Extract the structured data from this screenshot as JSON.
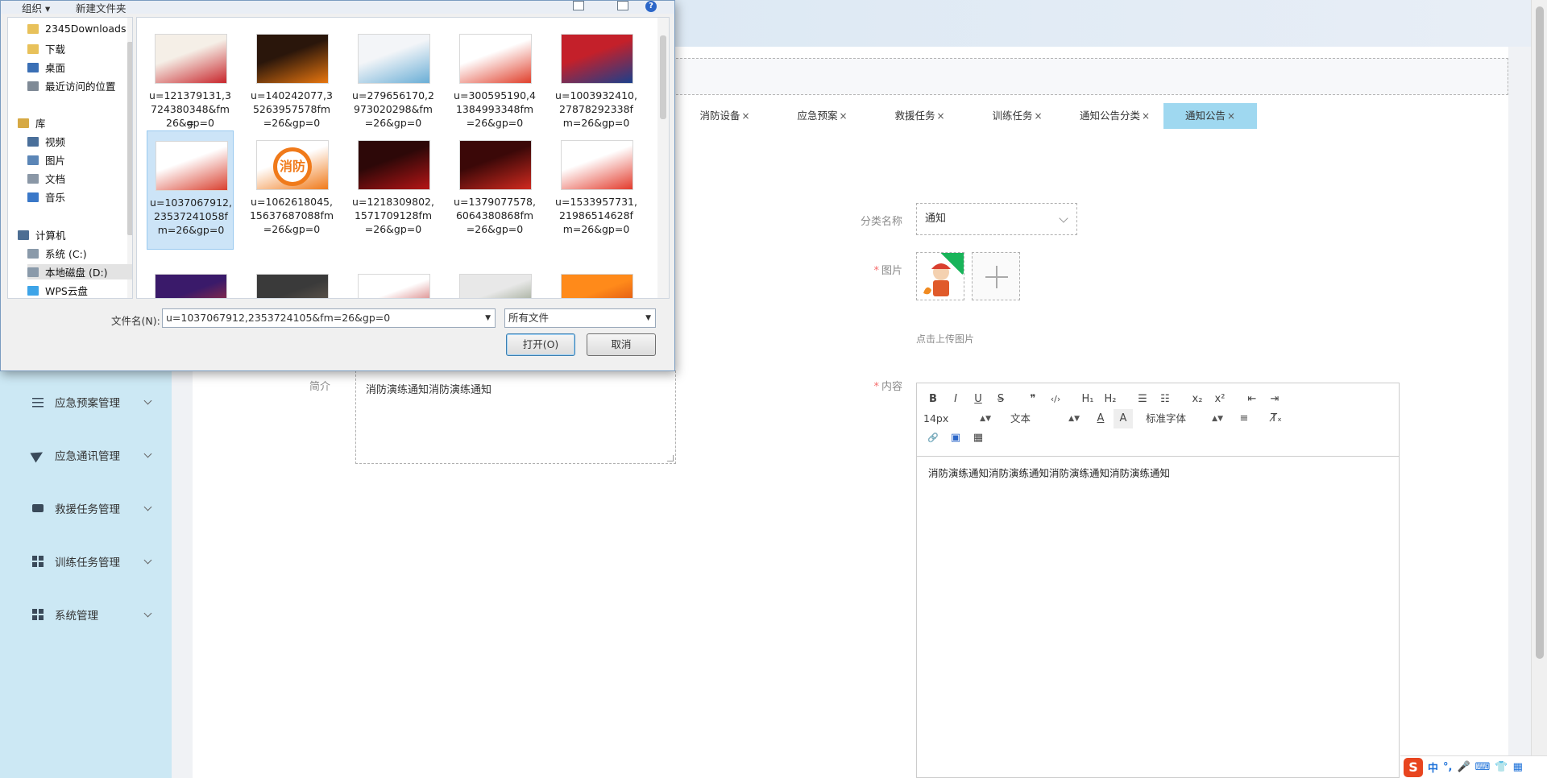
{
  "app": {
    "tabs": [
      {
        "label": "消防设备",
        "close": "×"
      },
      {
        "label": "应急预案",
        "close": "×"
      },
      {
        "label": "救援任务",
        "close": "×"
      },
      {
        "label": "训练任务",
        "close": "×"
      },
      {
        "label": "通知公告分类",
        "close": "×"
      },
      {
        "label": "通知公告",
        "close": "×"
      }
    ],
    "sidebar": {
      "items": [
        {
          "label": "应急预案管理",
          "icon": "sliders-icon"
        },
        {
          "label": "应急通讯管理",
          "icon": "paper-plane-icon"
        },
        {
          "label": "救援任务管理",
          "icon": "truck-icon"
        },
        {
          "label": "训练任务管理",
          "icon": "grid-icon"
        },
        {
          "label": "系统管理",
          "icon": "grid-icon"
        }
      ]
    },
    "form": {
      "category_label": "分类名称",
      "category_value": "通知",
      "image_label": "图片",
      "upload_hint": "点击上传图片",
      "intro_label": "简介",
      "intro_value": "消防演练通知消防演练通知",
      "content_label": "内容",
      "required_mark": "*",
      "content_value": "消防演练通知消防演练通知消防演练通知消防演练通知"
    },
    "editor": {
      "font_size": "14px",
      "block_format": "文本",
      "font_family": "标准字体",
      "bold": "B",
      "italic": "I",
      "underline": "U",
      "strike": "S",
      "quote": "❞",
      "code": "‹/›",
      "h1": "H₁",
      "h2": "H₂",
      "ordered_list": "☰",
      "bullet_list": "☷",
      "subscript": "x₂",
      "superscript": "x²",
      "outdent": "⇤",
      "indent": "⇥",
      "font_color": "A",
      "bg_color": "A",
      "align": "≡",
      "clear": "T̸ₓ",
      "link": "🔗",
      "image": "▣",
      "video": "▦",
      "select_arrow": "▲▼"
    },
    "ime": {
      "logo": "S",
      "lang": "中",
      "punct": "°,",
      "mic": "🎤",
      "kbd": "⌨",
      "skin": "👕",
      "menu": "▦"
    }
  },
  "dialog": {
    "toolbar": {
      "organize": "组织 ▾",
      "new_folder": "新建文件夹",
      "help": "?"
    },
    "nav": [
      {
        "label": "2345Downloads",
        "icon": "folder-icon",
        "color": "#e8c15a"
      },
      {
        "label": "下载",
        "icon": "download-folder-icon",
        "color": "#e8c15a"
      },
      {
        "label": "桌面",
        "icon": "desktop-icon",
        "color": "#3a6fb5"
      },
      {
        "label": "最近访问的位置",
        "icon": "recent-places-icon",
        "color": "#7f8a96"
      },
      {
        "label": "库",
        "icon": "library-icon",
        "color": "#d6a944"
      },
      {
        "label": "视频",
        "icon": "video-icon",
        "color": "#4a6f9a"
      },
      {
        "label": "图片",
        "icon": "pictures-icon",
        "color": "#5b86b7"
      },
      {
        "label": "文档",
        "icon": "documents-icon",
        "color": "#8a97a6"
      },
      {
        "label": "音乐",
        "icon": "music-icon",
        "color": "#3a78c8"
      },
      {
        "label": "计算机",
        "icon": "computer-icon",
        "color": "#4d6e93"
      },
      {
        "label": "系统 (C:)",
        "icon": "drive-c-icon",
        "color": "#8a9aaa"
      },
      {
        "label": "本地磁盘 (D:)",
        "icon": "drive-d-icon",
        "color": "#8a9aaa"
      },
      {
        "label": "WPS云盘",
        "icon": "cloud-icon",
        "color": "#3da4e8"
      }
    ],
    "files": [
      {
        "name": "u=121379131,3724380348&fm=26&gp=0",
        "lines": [
          "u=121379131,3",
          "724380348&fm=",
          "26&gp=0"
        ],
        "colors": [
          "#f5efe7",
          "#c8262c"
        ]
      },
      {
        "name": "u=140242077,35263957578fm=26&gp=0",
        "lines": [
          "u=140242077,3",
          "5263957578fm",
          "=26&gp=0"
        ],
        "colors": [
          "#2a160b",
          "#e8760f"
        ]
      },
      {
        "name": "u=279656170,2973020298&fm=26&gp=0",
        "lines": [
          "u=279656170,2",
          "973020298&fm",
          "=26&gp=0"
        ],
        "colors": [
          "#f3f5f8",
          "#6aaed6"
        ]
      },
      {
        "name": "u=300595190,41384993348fm=26&gp=0",
        "lines": [
          "u=300595190,4",
          "1384993348fm",
          "=26&gp=0"
        ],
        "colors": [
          "#ffffff",
          "#e0402c"
        ]
      },
      {
        "name": "u=1003932410,27878292338fm=26&gp=0",
        "lines": [
          "u=1003932410,",
          "27878292338f",
          "m=26&gp=0"
        ],
        "colors": [
          "#c4202a",
          "#1b3f8c"
        ]
      },
      {
        "name": "u=1037067912,23537241058fm=26&gp=0",
        "lines": [
          "u=1037067912,",
          "23537241058f",
          "m=26&gp=0"
        ],
        "colors": [
          "#ffffff",
          "#d9402f"
        ],
        "selected": true
      },
      {
        "name": "u=1062618045,15637687088fm=26&gp=0",
        "lines": [
          "u=1062618045,",
          "15637687088fm",
          "=26&gp=0"
        ],
        "colors": [
          "#ffffff",
          "#f07a1a"
        ],
        "text": "消防"
      },
      {
        "name": "u=1218309802,1571709128fm=26&gp=0",
        "lines": [
          "u=1218309802,",
          "1571709128fm",
          "=26&gp=0"
        ],
        "colors": [
          "#2d0808",
          "#b51516"
        ]
      },
      {
        "name": "u=1379077578,6064380868fm=26&gp=0",
        "lines": [
          "u=1379077578,",
          "6064380868fm",
          "=26&gp=0"
        ],
        "colors": [
          "#3b0808",
          "#d12a1f"
        ]
      },
      {
        "name": "u=1533957731,21986514628fm=26&gp=0",
        "lines": [
          "u=1533957731,",
          "21986514628f",
          "m=26&gp=0"
        ],
        "colors": [
          "#ffffff",
          "#e33b2c"
        ]
      },
      {
        "name": "row3-1",
        "colors": [
          "#3a1a6a",
          "#d43a2a"
        ]
      },
      {
        "name": "row3-2",
        "colors": [
          "#3a3a3a",
          "#7a6a5a"
        ]
      },
      {
        "name": "row3-3",
        "colors": [
          "#ffffff",
          "#b81c1c"
        ]
      },
      {
        "name": "row3-4",
        "colors": [
          "#e8e8e8",
          "#6a7a5a"
        ]
      },
      {
        "name": "row3-5",
        "colors": [
          "#ff8a1a",
          "#c8300e"
        ]
      }
    ],
    "filename_label": "文件名(N):",
    "filename_value": "u=1037067912,2353724105&fm=26&gp=0",
    "filetype_value": "所有文件",
    "open_button": "打开(O)",
    "cancel_button": "取消",
    "dropdown_arrow": "▼"
  }
}
